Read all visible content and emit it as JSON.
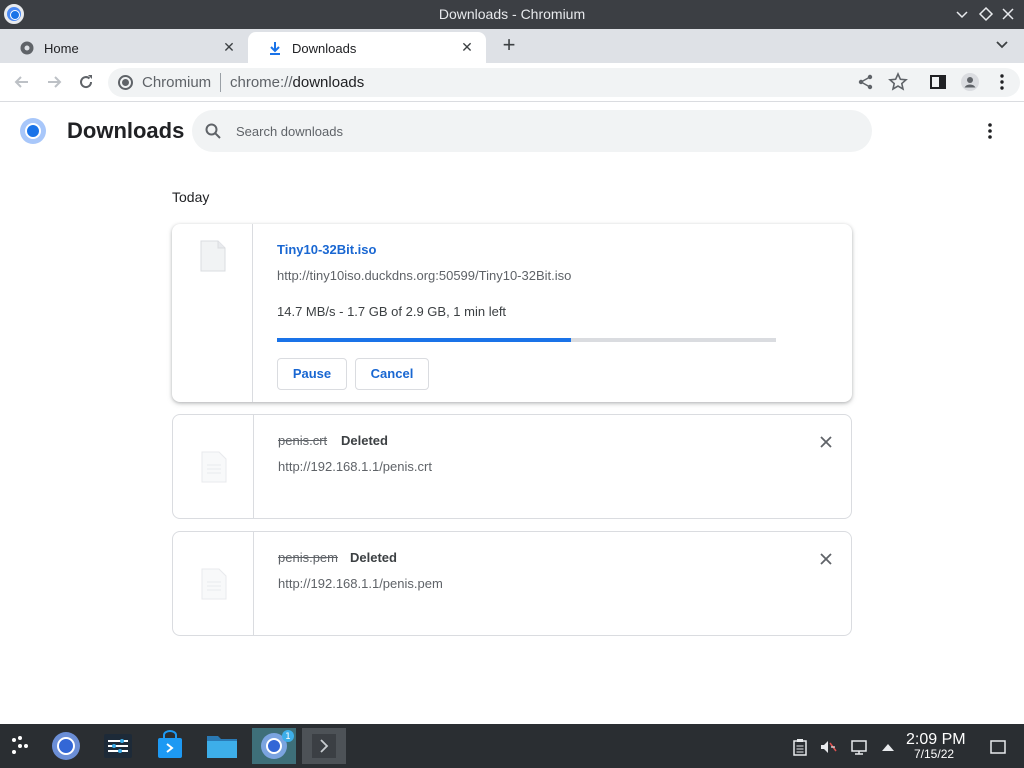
{
  "window": {
    "title": "Downloads - Chromium"
  },
  "tabs": [
    {
      "label": "Home",
      "icon": "home-icon",
      "active": false
    },
    {
      "label": "Downloads",
      "icon": "download-icon",
      "active": true
    }
  ],
  "toolbar": {
    "site_name": "Chromium",
    "url_scheme": "chrome://",
    "url_host": "downloads"
  },
  "page": {
    "title": "Downloads",
    "search_placeholder": "Search downloads",
    "section_label": "Today"
  },
  "downloads": [
    {
      "name": "Tiny10-32Bit.iso",
      "url": "http://tiny10iso.duckdns.org:50599/Tiny10-32Bit.iso",
      "progress_text": "14.7 MB/s - 1.7 GB of 2.9 GB, 1 min left",
      "progress": 0.59,
      "pause_label": "Pause",
      "cancel_label": "Cancel",
      "state": "in_progress"
    },
    {
      "name": "penis.crt",
      "status": "Deleted",
      "url": "http://192.168.1.1/penis.crt",
      "state": "deleted"
    },
    {
      "name": "penis.pem",
      "status": "Deleted",
      "url": "http://192.168.1.1/penis.pem",
      "state": "deleted"
    }
  ],
  "taskbar": {
    "apps": [
      "start-menu-icon",
      "chromium-icon",
      "settings-icon",
      "discover-store-icon",
      "file-manager-icon",
      "chromium-window-icon",
      "terminal-icon"
    ],
    "notification_badge": "1",
    "clock_time": "2:09 PM",
    "clock_date": "7/15/22"
  },
  "colors": {
    "accent": "#1a73e8",
    "link": "#1967d2",
    "taskbar": "#2a2e32",
    "titlebar": "#3c3f44"
  }
}
